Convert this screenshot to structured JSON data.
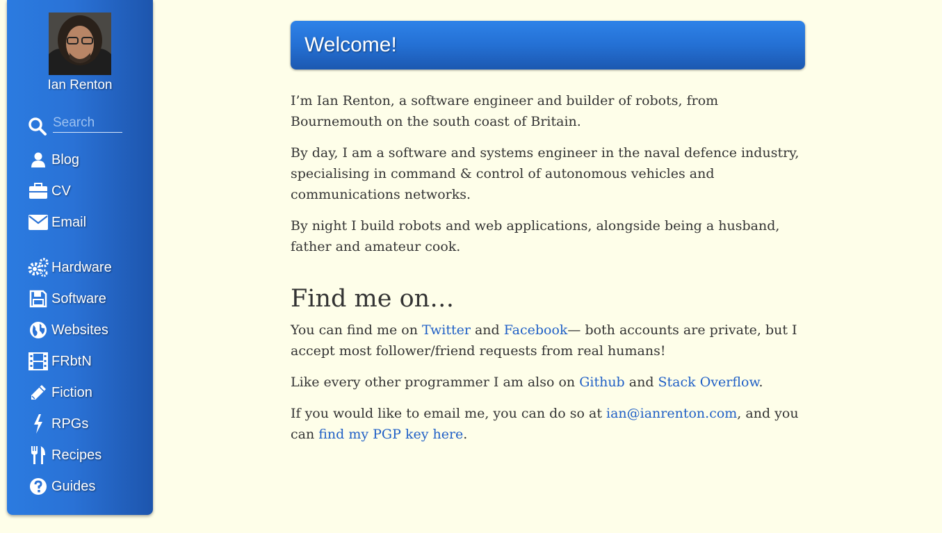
{
  "sidebar": {
    "user_name": "Ian Renton",
    "search_placeholder": "Search",
    "nav": [
      {
        "label": "Blog",
        "icon": "user-icon"
      },
      {
        "label": "CV",
        "icon": "briefcase-icon"
      },
      {
        "label": "Email",
        "icon": "envelope-icon"
      },
      {
        "label": "Hardware",
        "icon": "gears-icon"
      },
      {
        "label": "Software",
        "icon": "floppy-disk-icon"
      },
      {
        "label": "Websites",
        "icon": "globe-icon"
      },
      {
        "label": "FRbtN",
        "icon": "film-icon"
      },
      {
        "label": "Fiction",
        "icon": "pencil-icon"
      },
      {
        "label": "RPGs",
        "icon": "lightning-icon"
      },
      {
        "label": "Recipes",
        "icon": "cutlery-icon"
      },
      {
        "label": "Guides",
        "icon": "question-circle-icon"
      }
    ]
  },
  "main": {
    "banner_title": "Welcome!",
    "intro": {
      "p1": "I’m Ian Renton, a software engineer and builder of robots, from Bournemouth on the south coast of Britain.",
      "p2": "By day, I am a software and systems engineer in the naval defence industry, specialising in command & control of autonomous vehicles and communications networks.",
      "p3": "By night I build robots and web applications, alongside being a husband, father and amateur cook."
    },
    "find_heading": "Find me on…",
    "social": {
      "prefix": "You can find me on ",
      "twitter": "Twitter",
      "and1": " and ",
      "facebook": "Facebook",
      "suffix": "— both accounts are private, but I accept most follower/friend requests from real humans!"
    },
    "dev": {
      "prefix": "Like every other programmer I am also on ",
      "github": "Github",
      "and": " and ",
      "stackoverflow": "Stack Overflow",
      "suffix": "."
    },
    "email": {
      "prefix": "If you would like to email me, you can do so at ",
      "address": "ian@ianrenton.com",
      "middle": ", and you can ",
      "pgp": "find my PGP key here",
      "suffix": "."
    }
  },
  "colors": {
    "page_background": "#fefee9",
    "sidebar_blue": "#2a72d6",
    "link": "#1f5fc6",
    "text": "#333333"
  }
}
